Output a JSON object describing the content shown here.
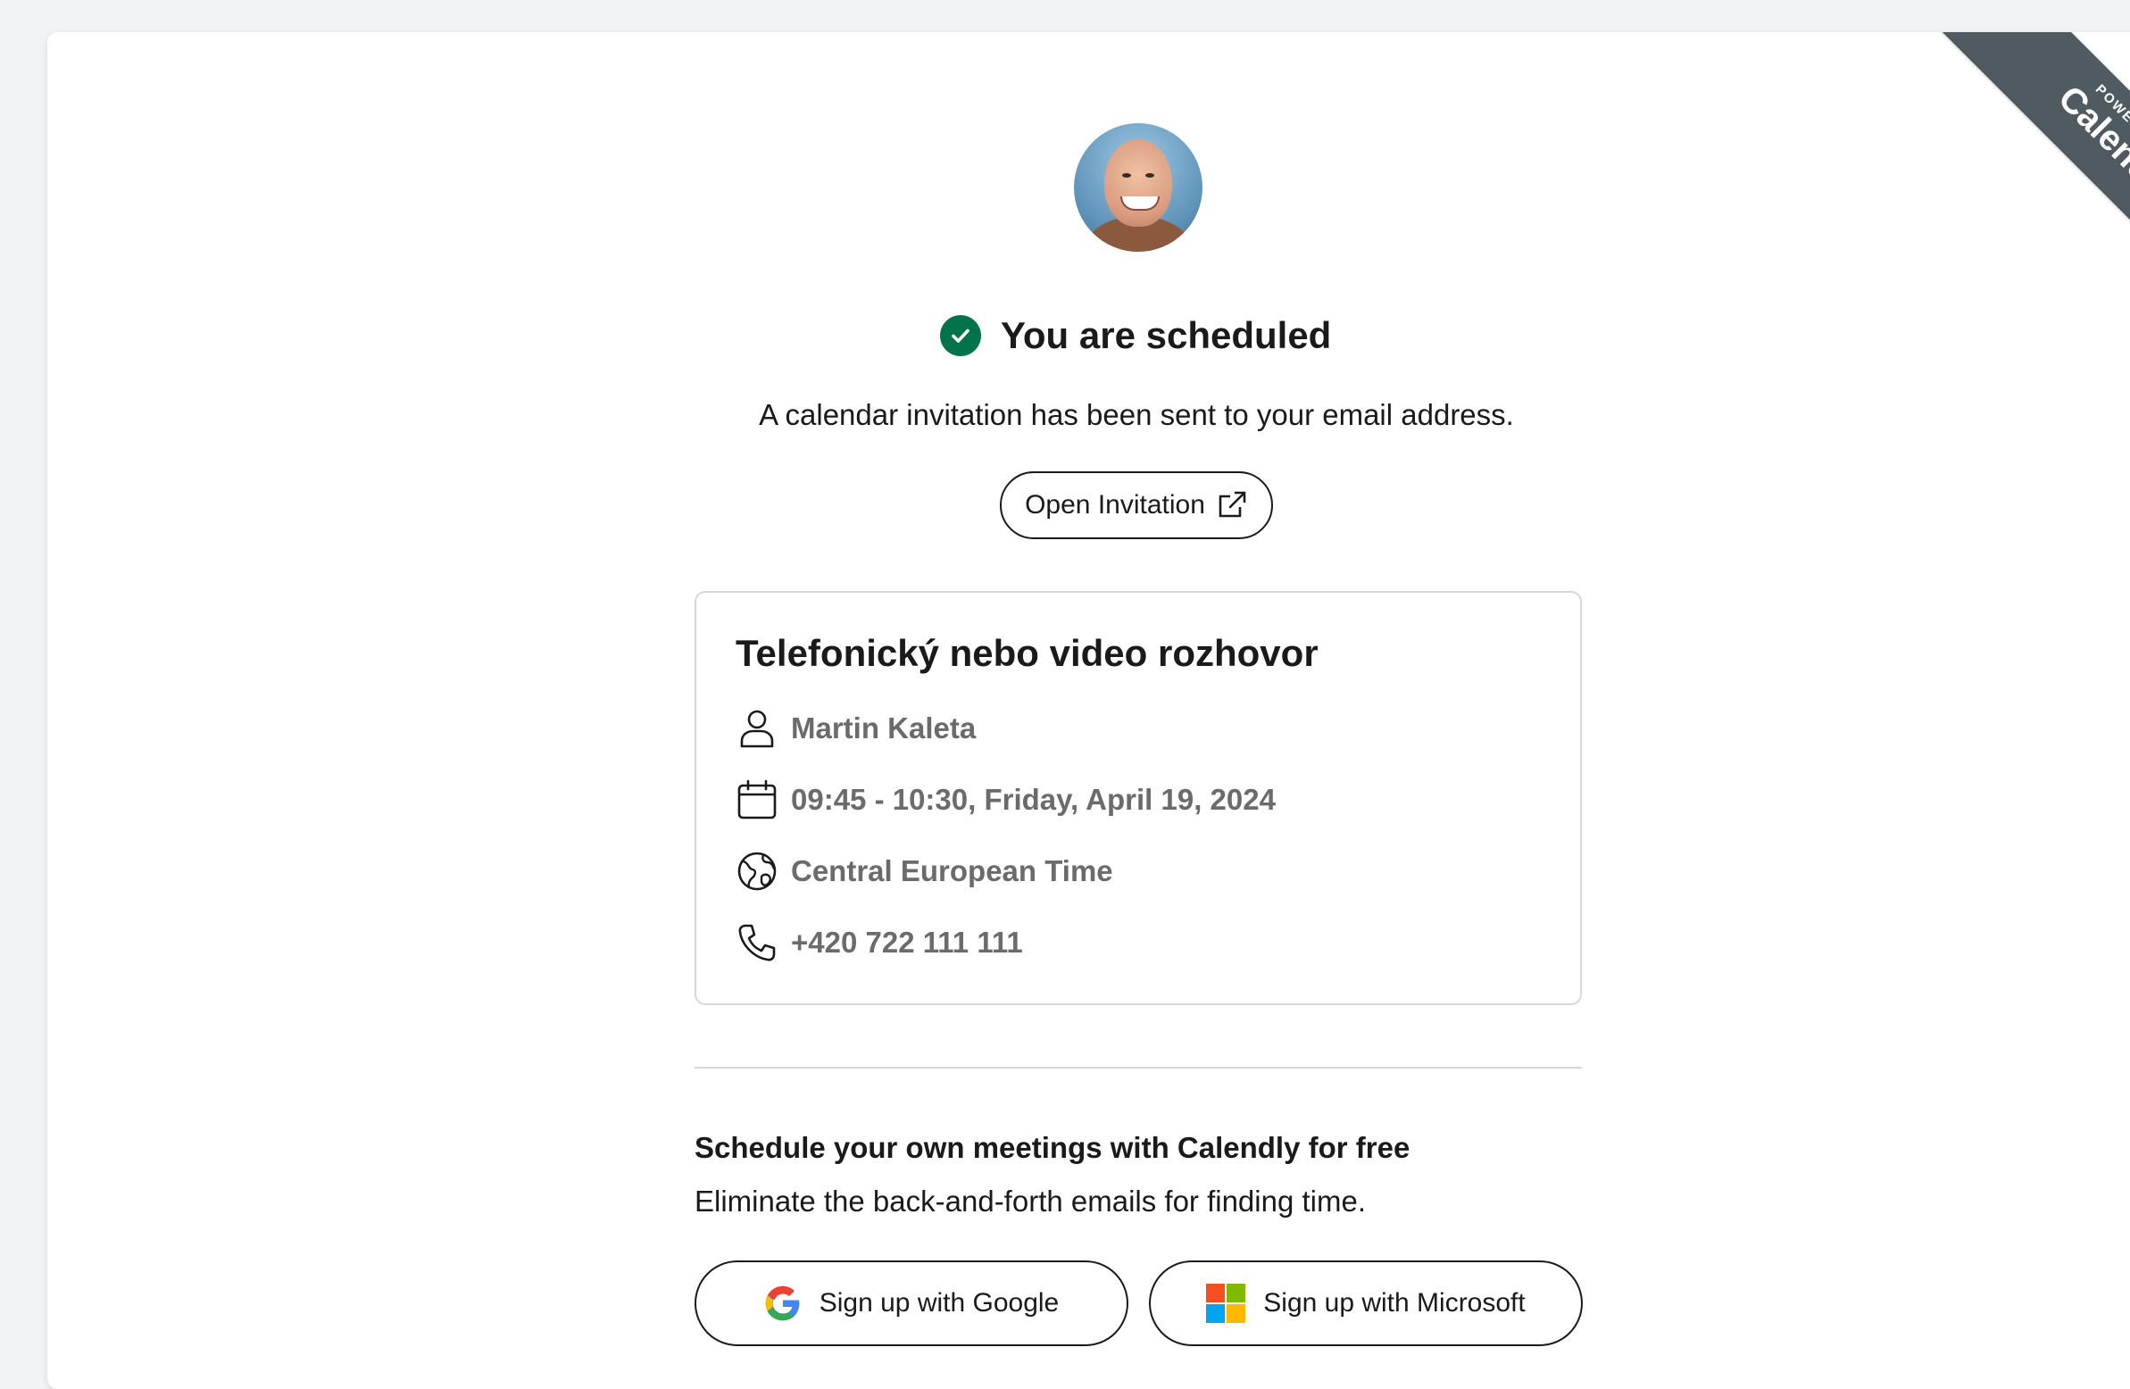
{
  "ribbon": {
    "powered_by": "POWERED BY",
    "brand": "Calendly"
  },
  "confirmation": {
    "title": "You are scheduled",
    "subtitle": "A calendar invitation has been sent to your email address.",
    "open_invitation_label": "Open Invitation"
  },
  "event": {
    "title": "Telefonický nebo video rozhovor",
    "host": "Martin Kaleta",
    "datetime": "09:45 - 10:30, Friday, April 19, 2024",
    "timezone": "Central European Time",
    "phone": "+420 722 111 111"
  },
  "promo": {
    "title": "Schedule your own meetings with Calendly for free",
    "subtitle": "Eliminate the back-and-forth emails for finding time.",
    "google_label": "Sign up with Google",
    "microsoft_label": "Sign up with Microsoft"
  },
  "icons": {
    "check": "check-circle-icon",
    "external": "external-link-icon",
    "person": "person-icon",
    "calendar": "calendar-icon",
    "globe": "globe-icon",
    "phone": "phone-icon",
    "google": "google-logo-icon",
    "microsoft": "microsoft-logo-icon"
  },
  "colors": {
    "success": "#00734a",
    "ribbon": "#505a61",
    "detail_text": "#6b6b6b",
    "border": "#d8d8d8"
  }
}
